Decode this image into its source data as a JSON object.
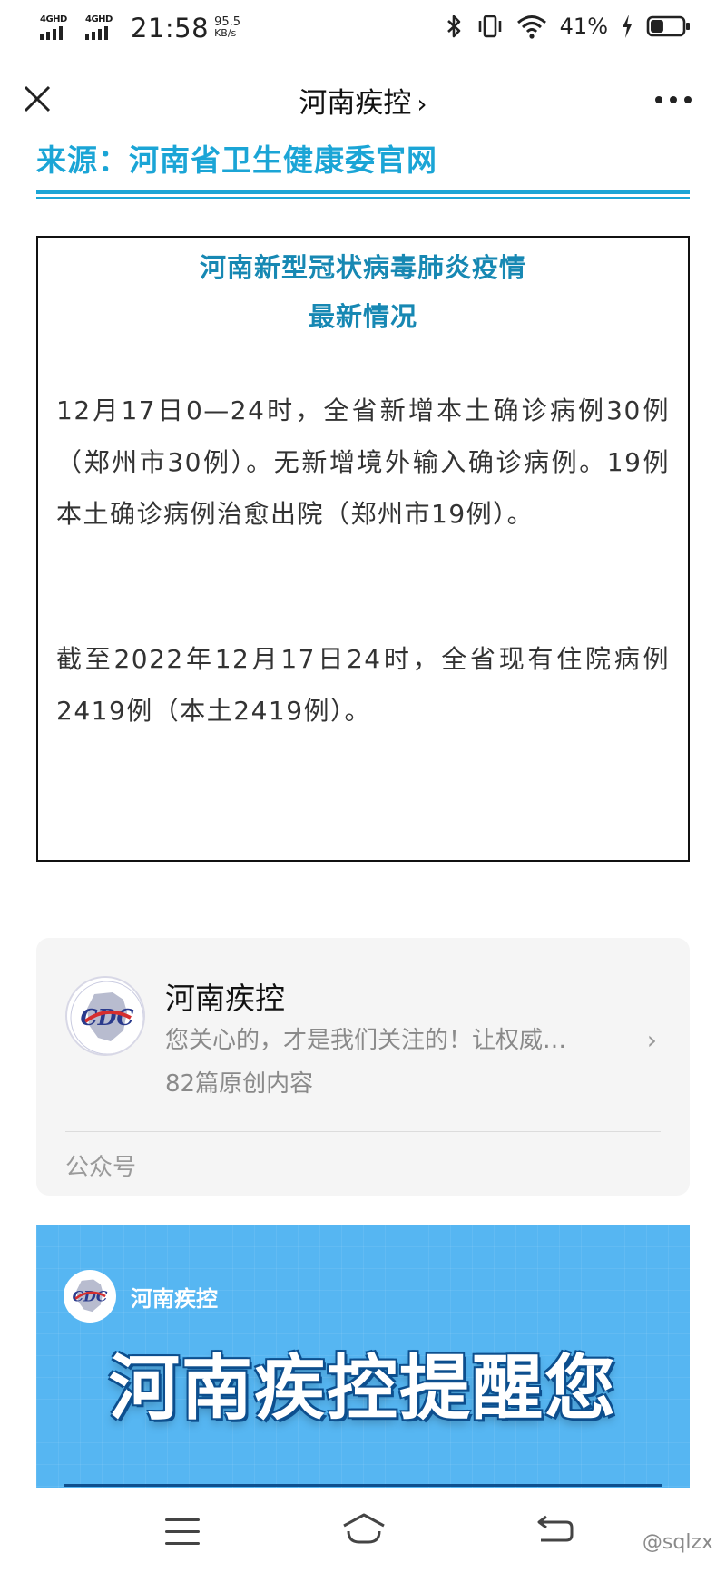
{
  "status_bar": {
    "sim1_label": "4GHD",
    "sim2_label": "4GHD",
    "time": "21:58",
    "net_speed": "95.5",
    "net_speed_unit": "KB/s",
    "battery_percent": "41%",
    "battery_level": 0.41,
    "icons": [
      "bluetooth-icon",
      "vibrate-icon",
      "wifi-icon",
      "charging-icon",
      "battery-icon"
    ]
  },
  "nav": {
    "title": "河南疾控",
    "title_chevron": "›",
    "icons": [
      "close-icon",
      "more-icon"
    ]
  },
  "article": {
    "source": "来源：河南省卫生健康委官网",
    "title_line1": "河南新型冠状病毒肺炎疫情",
    "title_line2": "最新情况",
    "paragraph1": "12月17日0—24时，全省新增本土确诊病例30例（郑州市30例）。无新增境外输入确诊病例。19例本土确诊病例治愈出院（郑州市19例）。",
    "paragraph2": "截至2022年12月17日24时，全省现有住院病例2419例（本土2419例）。"
  },
  "account_card": {
    "name": "河南疾控",
    "description": "您关心的，才是我们关注的！让权威…",
    "article_count": "82篇原创内容",
    "footer": "公众号",
    "chevron": "›"
  },
  "banner": {
    "org_name": "河南疾控",
    "headline": "河南疾控提醒您"
  },
  "bottom_nav": {
    "icons": [
      "menu-icon",
      "home-icon",
      "back-icon"
    ],
    "watermark": "@sqlzx"
  },
  "colors": {
    "accent": "#1ba5d6",
    "title_blue": "#1788b3",
    "banner_bg": "#56b6f2",
    "banner_outline": "#0d4f8e",
    "cdc_red": "#d62e2e",
    "cdc_blue": "#2a3a8c"
  }
}
